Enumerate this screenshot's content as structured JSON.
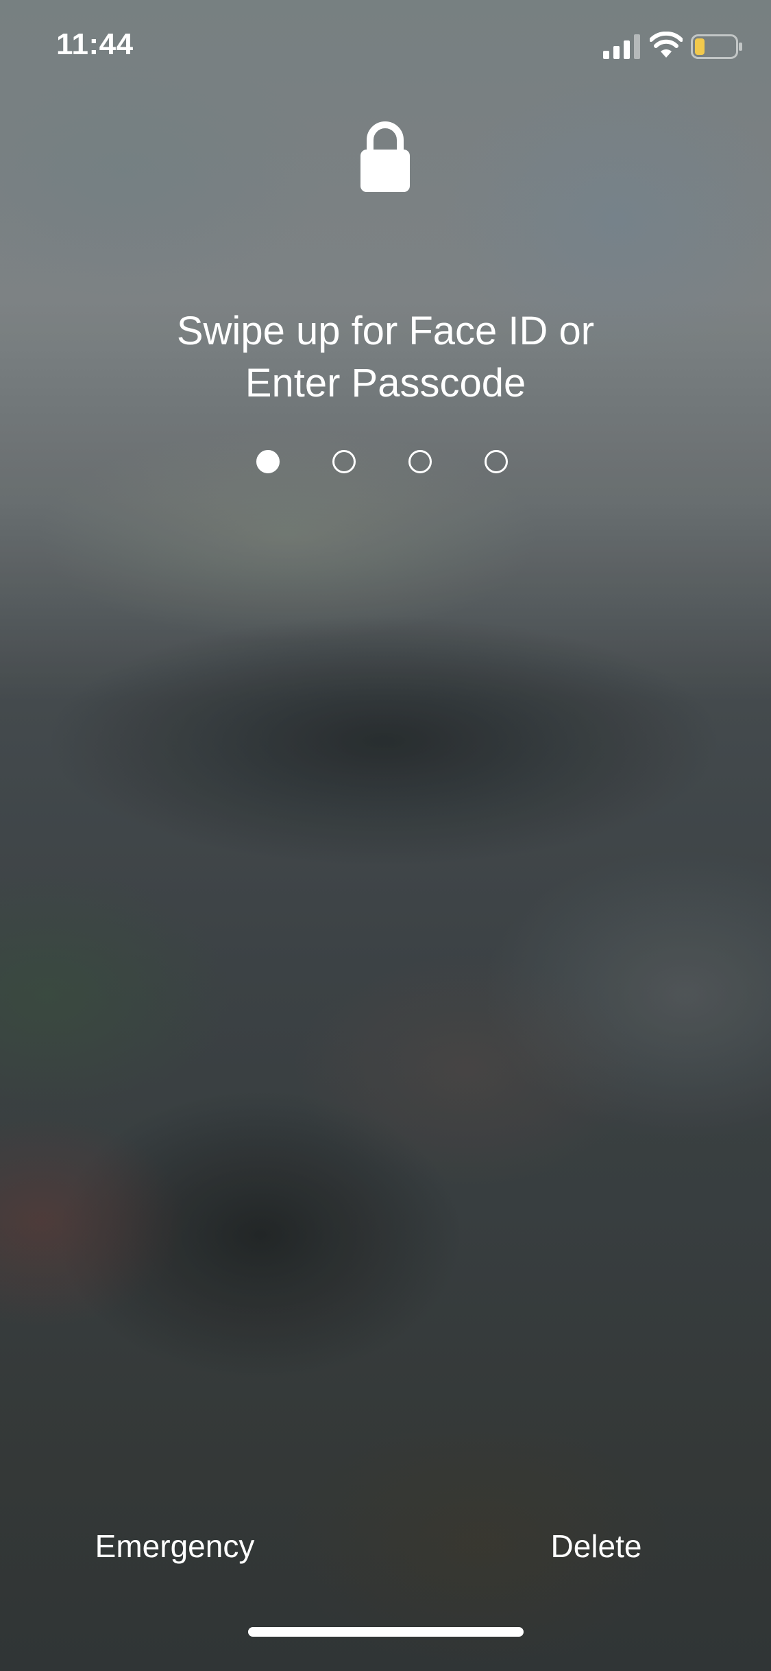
{
  "status_bar": {
    "time": "11:44",
    "signal_icon": "cellular-signal-icon",
    "wifi_icon": "wifi-icon",
    "battery_icon": "battery-low-icon",
    "battery_fill_color": "#f2c94c"
  },
  "lock": {
    "icon": "lock-icon",
    "prompt_line1": "Swipe up for Face ID or",
    "prompt_line2": "Enter Passcode"
  },
  "passcode": {
    "total_digits": 4,
    "entered_digits": 1
  },
  "buttons": {
    "emergency_label": "Emergency",
    "delete_label": "Delete"
  }
}
